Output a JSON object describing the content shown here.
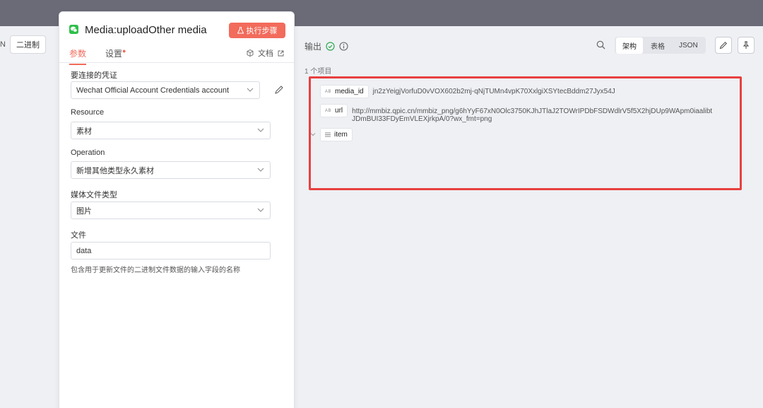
{
  "left_strip": {
    "partial_label": "N",
    "binary_button": "二进制"
  },
  "panel": {
    "title": "Media:uploadOther media",
    "exec_button": "执行步骤",
    "tabs": {
      "params": "参数",
      "settings": "设置",
      "docs": "文档"
    },
    "fields": {
      "credential_label": "要连接的凭证",
      "credential_value": "Wechat Official Account Credentials account",
      "resource_label": "Resource",
      "resource_value": "素材",
      "operation_label": "Operation",
      "operation_value": "新增其他类型永久素材",
      "media_type_label": "媒体文件类型",
      "media_type_value": "图片",
      "file_label": "文件",
      "file_value": "data",
      "file_hint": "包含用于更新文件的二进制文件数据的输入字段的名称"
    }
  },
  "output": {
    "title": "输出",
    "count": "1 个项目",
    "view_tabs": [
      "架构",
      "表格",
      "JSON"
    ],
    "active_view": "架构",
    "rows": [
      {
        "type": "AB",
        "key": "media_id",
        "value": "jn2zYeigjVorfuD0vVOX602b2mj-qNjTUMn4vpK70XxlgiXSYtecBddm27Jyx54J"
      },
      {
        "type": "AB",
        "key": "url",
        "value_line1": "http://mmbiz.qpic.cn/mmbiz_png/g6hYyF67xN0Olc3750KJhJTlaJ2TOWrIPDbFSDWdlrV5f5X2hjDUp9WApm0iaalibt",
        "value_line2": "JDmBUI33FDyEmVLEXjrkpA/0?wx_fmt=png"
      },
      {
        "type": "list",
        "key": "item"
      }
    ]
  },
  "colors": {
    "accent": "#f26b5b",
    "highlight": "#e8403f",
    "success": "#2fa84f"
  }
}
